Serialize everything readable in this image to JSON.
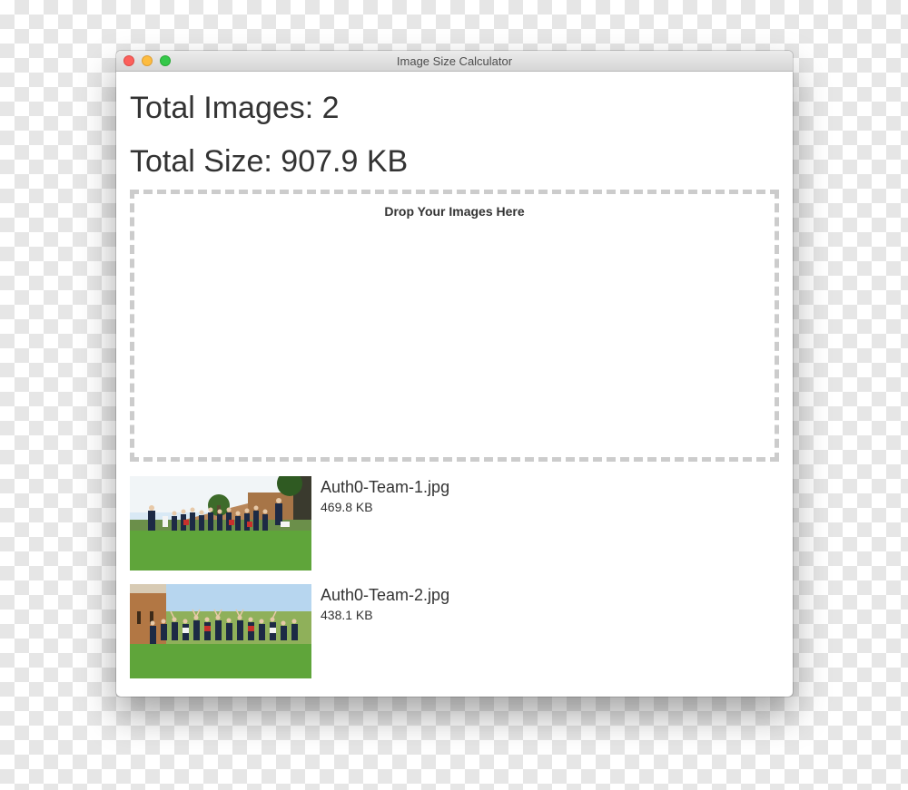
{
  "window": {
    "title": "Image Size Calculator"
  },
  "summary": {
    "total_images": "Total Images: 2",
    "total_size": "Total Size: 907.9 KB"
  },
  "dropzone": {
    "label": "Drop Your Images Here"
  },
  "images": [
    {
      "name": "Auth0-Team-1.jpg",
      "size": "469.8 KB"
    },
    {
      "name": "Auth0-Team-2.jpg",
      "size": "438.1 KB"
    }
  ]
}
